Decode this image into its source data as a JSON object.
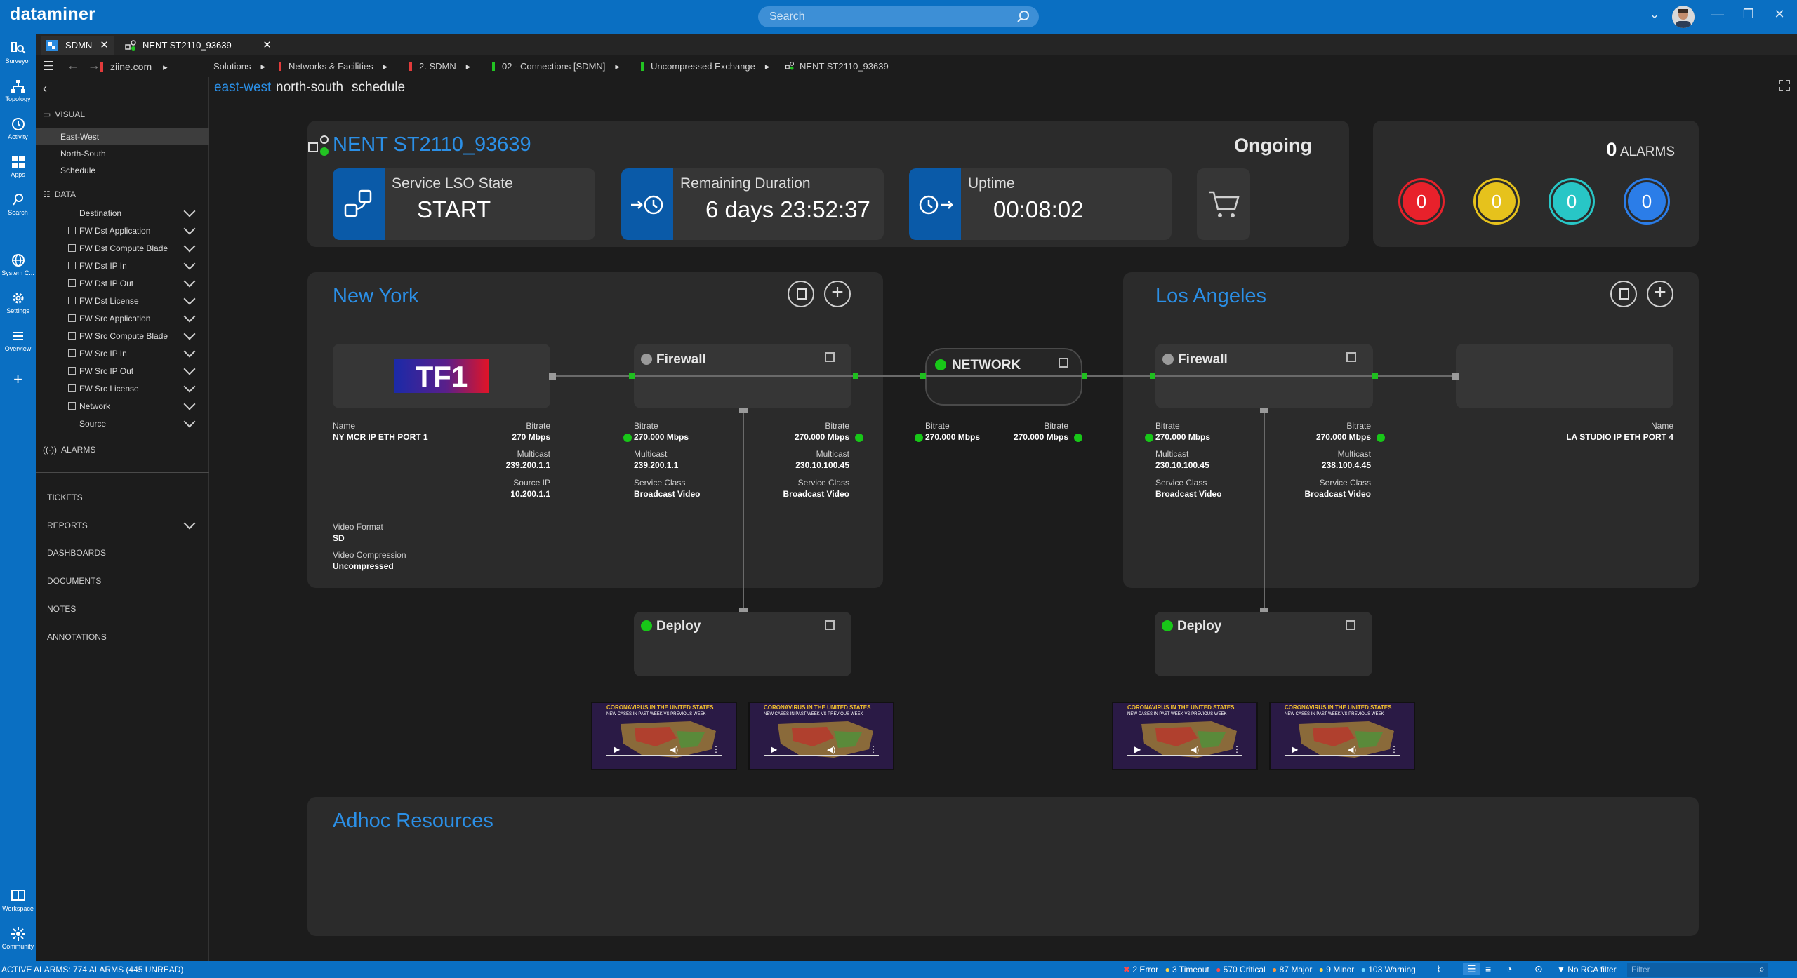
{
  "app": {
    "title": "dataminer",
    "search_placeholder": "Search"
  },
  "rail": [
    {
      "label": "Surveyor",
      "icon": "surveyor-icon"
    },
    {
      "label": "Topology",
      "icon": "topology-icon"
    },
    {
      "label": "Activity",
      "icon": "activity-icon"
    },
    {
      "label": "Apps",
      "icon": "apps-icon"
    },
    {
      "label": "Search",
      "icon": "search-icon"
    },
    {
      "label": "System C...",
      "icon": "globe-icon"
    },
    {
      "label": "Settings",
      "icon": "gear-icon"
    },
    {
      "label": "Overview",
      "icon": "list-icon"
    },
    {
      "label": "Workspace",
      "icon": "workspace-icon"
    },
    {
      "label": "Community",
      "icon": "community-icon"
    }
  ],
  "tabs": [
    {
      "label": "SDMN"
    },
    {
      "label": "NENT ST2110_93639"
    }
  ],
  "breadcrumb": [
    {
      "label": "ziine.com",
      "flag": "#e23b3b"
    },
    {
      "label": "Solutions",
      "flag": "#e23b3b"
    },
    {
      "label": "Networks & Facilities",
      "flag": "#e23b3b"
    },
    {
      "label": "2. SDMN",
      "flag": "#e23b3b"
    },
    {
      "label": "02 - Connections [SDMN]",
      "flag": "#22c322"
    },
    {
      "label": "Uncompressed Exchange",
      "flag": "#22c322"
    },
    {
      "label": "NENT ST2110_93639",
      "flag": ""
    }
  ],
  "sidebar": {
    "visual_title": "VISUAL",
    "visual_items": [
      "East-West",
      "North-South",
      "Schedule"
    ],
    "data_title": "DATA",
    "data_items": [
      "Destination",
      "FW Dst Application",
      "FW Dst Compute Blade",
      "FW Dst IP In",
      "FW Dst IP Out",
      "FW Dst License",
      "FW Src Application",
      "FW Src Compute Blade",
      "FW Src IP In",
      "FW Src IP Out",
      "FW Src License",
      "Network",
      "Source"
    ],
    "alarms_title": "ALARMS",
    "sections": [
      "TICKETS",
      "REPORTS",
      "DASHBOARDS",
      "DOCUMENTS",
      "NOTES",
      "ANNOTATIONS"
    ]
  },
  "subtabs": [
    "east-west",
    "north-south",
    "schedule"
  ],
  "service": {
    "name": "NENT ST2110_93639",
    "status": "Ongoing",
    "lso_label": "Service LSO State",
    "lso_value": "START",
    "remaining_label": "Remaining Duration",
    "remaining_value": "6 days 23:52:37",
    "uptime_label": "Uptime",
    "uptime_value": "00:08:02"
  },
  "alarms": {
    "count": "0",
    "label": "ALARMS",
    "items": [
      {
        "value": "0",
        "color": "#e8212b"
      },
      {
        "value": "0",
        "color": "#e6c21c"
      },
      {
        "value": "0",
        "color": "#28c6c6"
      },
      {
        "value": "0",
        "color": "#2b7de8"
      }
    ]
  },
  "ny": {
    "title": "New York",
    "source": {
      "name_label": "Name",
      "name_value": "NY MCR IP ETH PORT 1",
      "bitrate_label": "Bitrate",
      "bitrate_value": "270 Mbps",
      "multicast_label": "Multicast",
      "multicast_value": "239.200.1.1",
      "sourceip_label": "Source IP",
      "sourceip_value": "10.200.1.1",
      "vf_label": "Video Format",
      "vf_value": "SD",
      "vc_label": "Video Compression",
      "vc_value": "Uncompressed"
    },
    "firewall": {
      "title": "Firewall",
      "in_bitrate_label": "Bitrate",
      "in_bitrate": "270.000 Mbps",
      "in_multicast_label": "Multicast",
      "in_multicast": "239.200.1.1",
      "in_sc_label": "Service Class",
      "in_sc": "Broadcast Video",
      "out_bitrate_label": "Bitrate",
      "out_bitrate": "270.000 Mbps",
      "out_multicast_label": "Multicast",
      "out_multicast": "230.10.100.45",
      "out_sc_label": "Service Class",
      "out_sc": "Broadcast Video"
    },
    "deploy": {
      "title": "Deploy"
    }
  },
  "network": {
    "title": "NETWORK",
    "in_label": "Bitrate",
    "in_value": "270.000 Mbps",
    "out_label": "Bitrate",
    "out_value": "270.000 Mbps"
  },
  "la": {
    "title": "Los Angeles",
    "firewall": {
      "title": "Firewall",
      "in_bitrate_label": "Bitrate",
      "in_bitrate": "270.000 Mbps",
      "in_multicast_label": "Multicast",
      "in_multicast": "230.10.100.45",
      "in_sc_label": "Service Class",
      "in_sc": "Broadcast Video",
      "out_bitrate_label": "Bitrate",
      "out_bitrate": "270.000 Mbps",
      "out_multicast_label": "Multicast",
      "out_multicast": "238.100.4.45",
      "out_sc_label": "Service Class",
      "out_sc": "Broadcast Video"
    },
    "destination": {
      "name_label": "Name",
      "name_value": "LA STUDIO IP ETH PORT 4"
    },
    "deploy": {
      "title": "Deploy"
    }
  },
  "logo_text": "TF1",
  "thumb": {
    "line1": "CORONAVIRUS IN THE UNITED STATES",
    "line2": "NEW CASES IN PAST WEEK VS PREVIOUS WEEK"
  },
  "adhoc": {
    "title": "Adhoc Resources"
  },
  "status": {
    "left": "ACTIVE ALARMS: 774 ALARMS (445 UNREAD)",
    "error": "2 Error",
    "timeout": "3 Timeout",
    "critical": "570 Critical",
    "major": "87 Major",
    "minor": "9 Minor",
    "warning": "103 Warning",
    "rca": "No RCA filter",
    "filter_placeholder": "Filter"
  }
}
